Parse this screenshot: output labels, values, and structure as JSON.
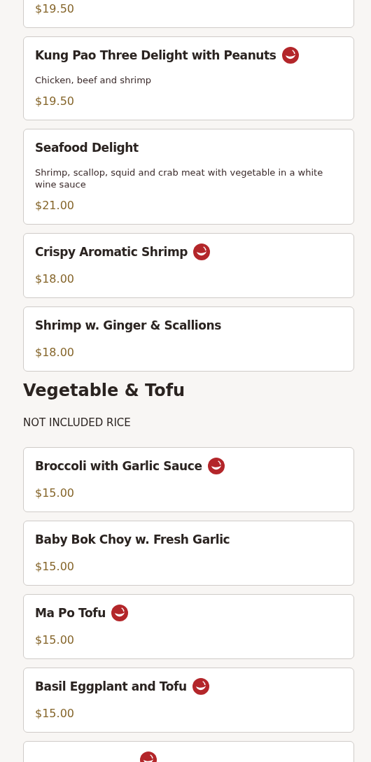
{
  "sections": [
    {
      "items": [
        {
          "price": "$19.50"
        },
        {
          "name": "Kung Pao Three Delight with Peanuts",
          "spicy": true,
          "description": "Chicken, beef and shrimp",
          "price": "$19.50"
        },
        {
          "name": "Seafood Delight",
          "spicy": false,
          "description": "Shrimp, scallop, squid and crab meat with vegetable in a white wine sauce",
          "price": "$21.00"
        },
        {
          "name": "Crispy Aromatic Shrimp",
          "spicy": true,
          "price": "$18.00"
        },
        {
          "name": "Shrimp w. Ginger & Scallions",
          "spicy": false,
          "price": "$18.00"
        }
      ]
    },
    {
      "title": "Vegetable & Tofu",
      "note": "NOT INCLUDED RICE",
      "items": [
        {
          "name": "Broccoli with Garlic Sauce",
          "spicy": true,
          "price": "$15.00"
        },
        {
          "name": "Baby Bok Choy w. Fresh Garlic",
          "spicy": false,
          "price": "$15.00"
        },
        {
          "name": "Ma Po Tofu",
          "spicy": true,
          "price": "$15.00"
        },
        {
          "name": "Basil Eggplant and Tofu",
          "spicy": true,
          "price": "$15.00"
        },
        {
          "spicy": true
        }
      ]
    }
  ]
}
